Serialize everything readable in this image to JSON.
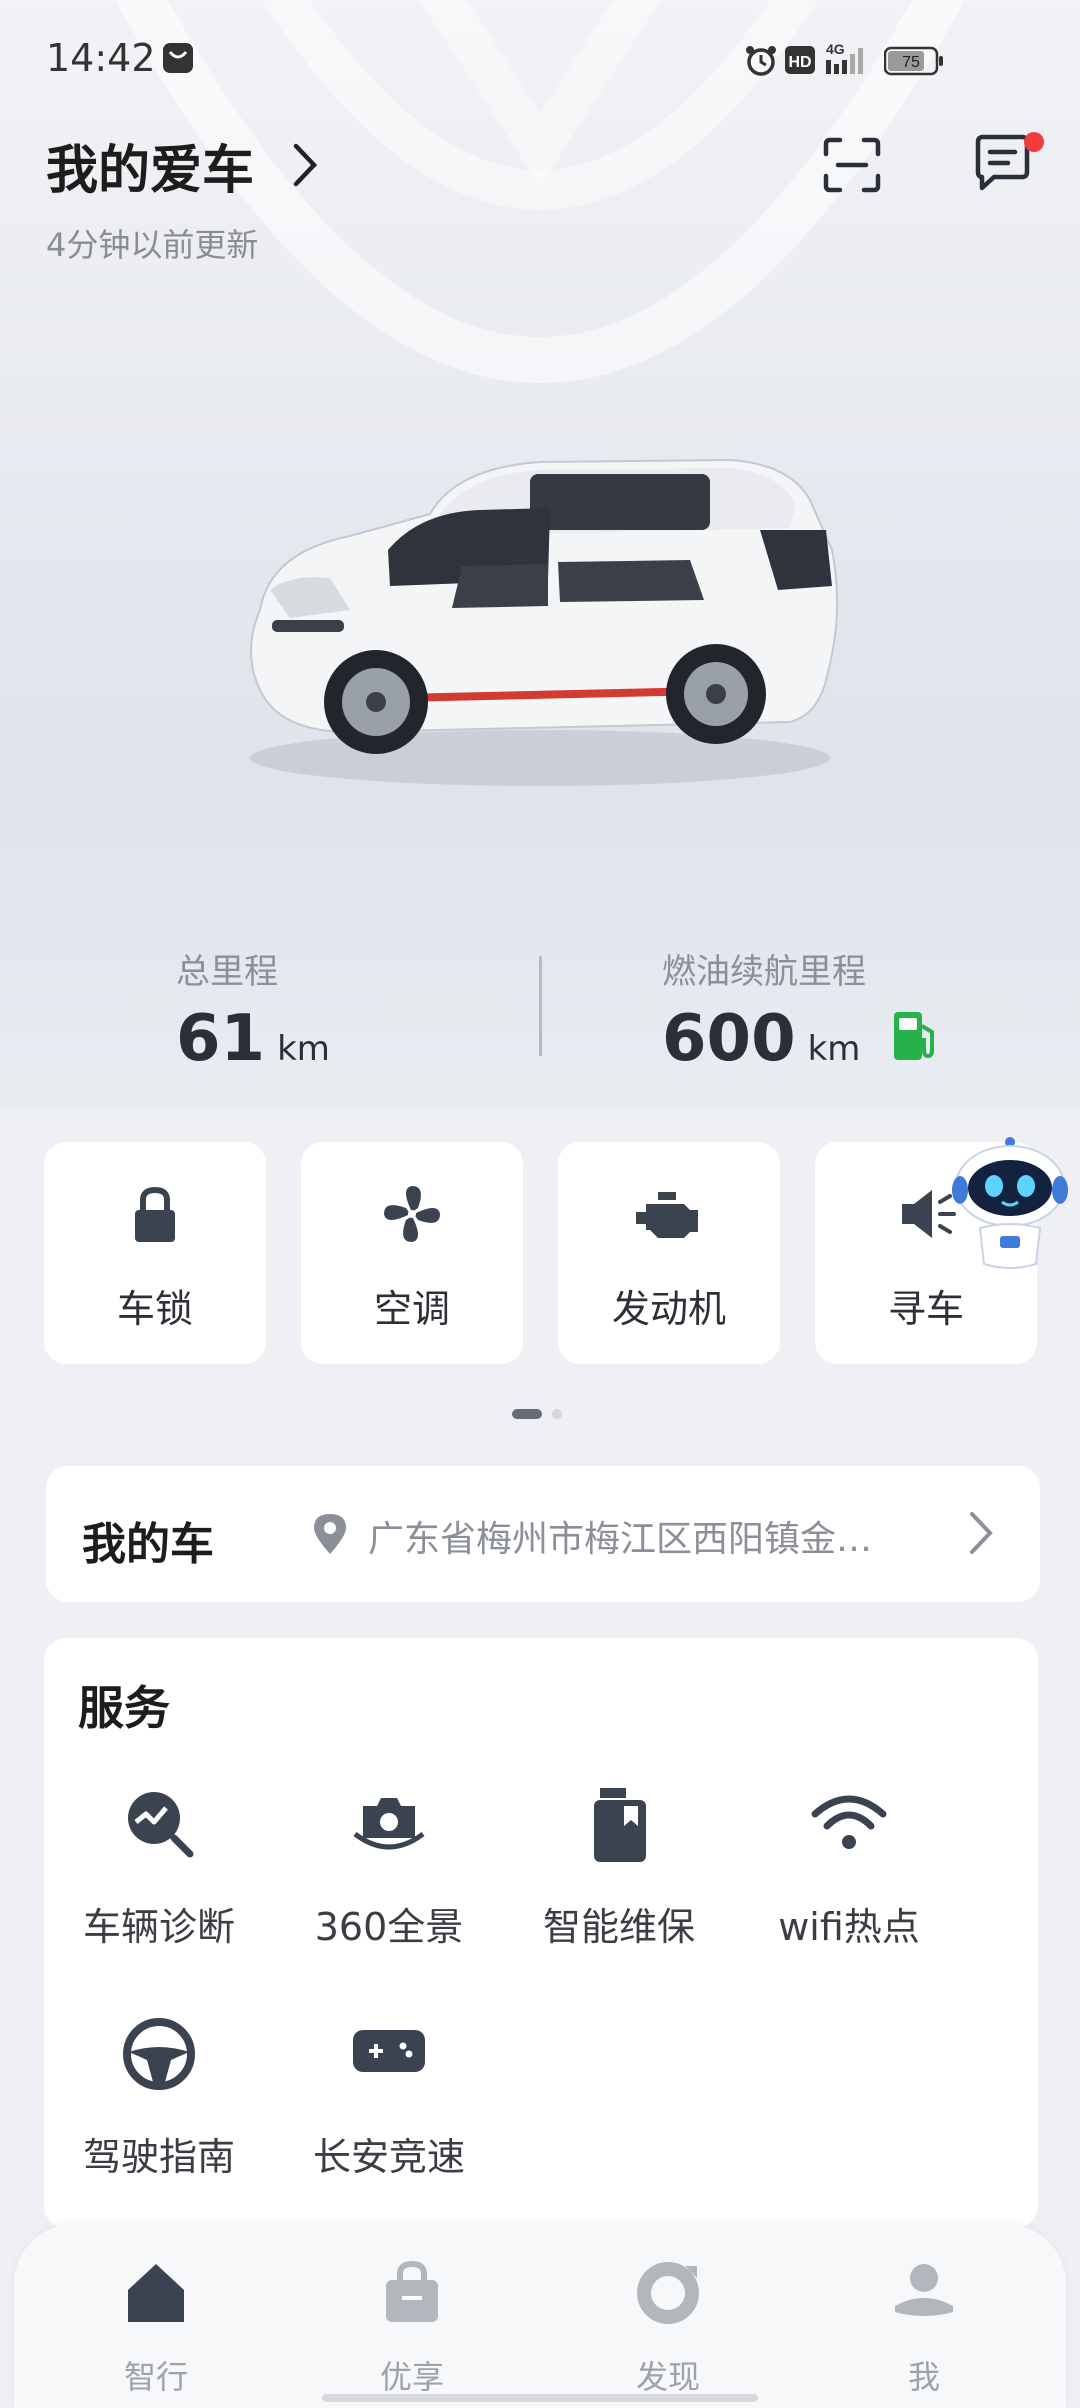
{
  "status_bar": {
    "time": "14:42",
    "battery": "75",
    "network": "4G"
  },
  "header": {
    "title": "我的爱车",
    "subtitle": "4分钟以前更新"
  },
  "stats": {
    "total_label": "总里程",
    "total_value": "61",
    "total_unit": "km",
    "range_label": "燃油续航里程",
    "range_value": "600",
    "range_unit": "km"
  },
  "controls": [
    {
      "label": "车锁",
      "icon": "lock-icon"
    },
    {
      "label": "空调",
      "icon": "fan-icon"
    },
    {
      "label": "发动机",
      "icon": "engine-icon"
    },
    {
      "label": "寻车",
      "icon": "speaker-icon"
    }
  ],
  "pager": {
    "pages": 2,
    "current": 1
  },
  "my_car": {
    "title": "我的车",
    "address": "广东省梅州市梅江区西阳镇金…"
  },
  "service": {
    "title": "服务",
    "items": [
      {
        "label": "车辆诊断",
        "icon": "diagnosis-icon"
      },
      {
        "label": "360全景",
        "icon": "camera-360-icon"
      },
      {
        "label": "智能维保",
        "icon": "maintenance-icon"
      },
      {
        "label": "wifi热点",
        "icon": "wifi-icon"
      },
      {
        "label": "驾驶指南",
        "icon": "steering-wheel-icon"
      },
      {
        "label": "长安竞速",
        "icon": "gamepad-icon"
      }
    ]
  },
  "tabs": [
    {
      "label": "智行",
      "icon": "home-icon",
      "active": true
    },
    {
      "label": "优享",
      "icon": "bag-icon"
    },
    {
      "label": "发现",
      "icon": "discover-icon"
    },
    {
      "label": "我",
      "icon": "user-icon"
    }
  ],
  "colors": {
    "fuel_green": "#27b14b",
    "icon_dark": "#3b4350",
    "badge_red": "#f03c3c"
  }
}
